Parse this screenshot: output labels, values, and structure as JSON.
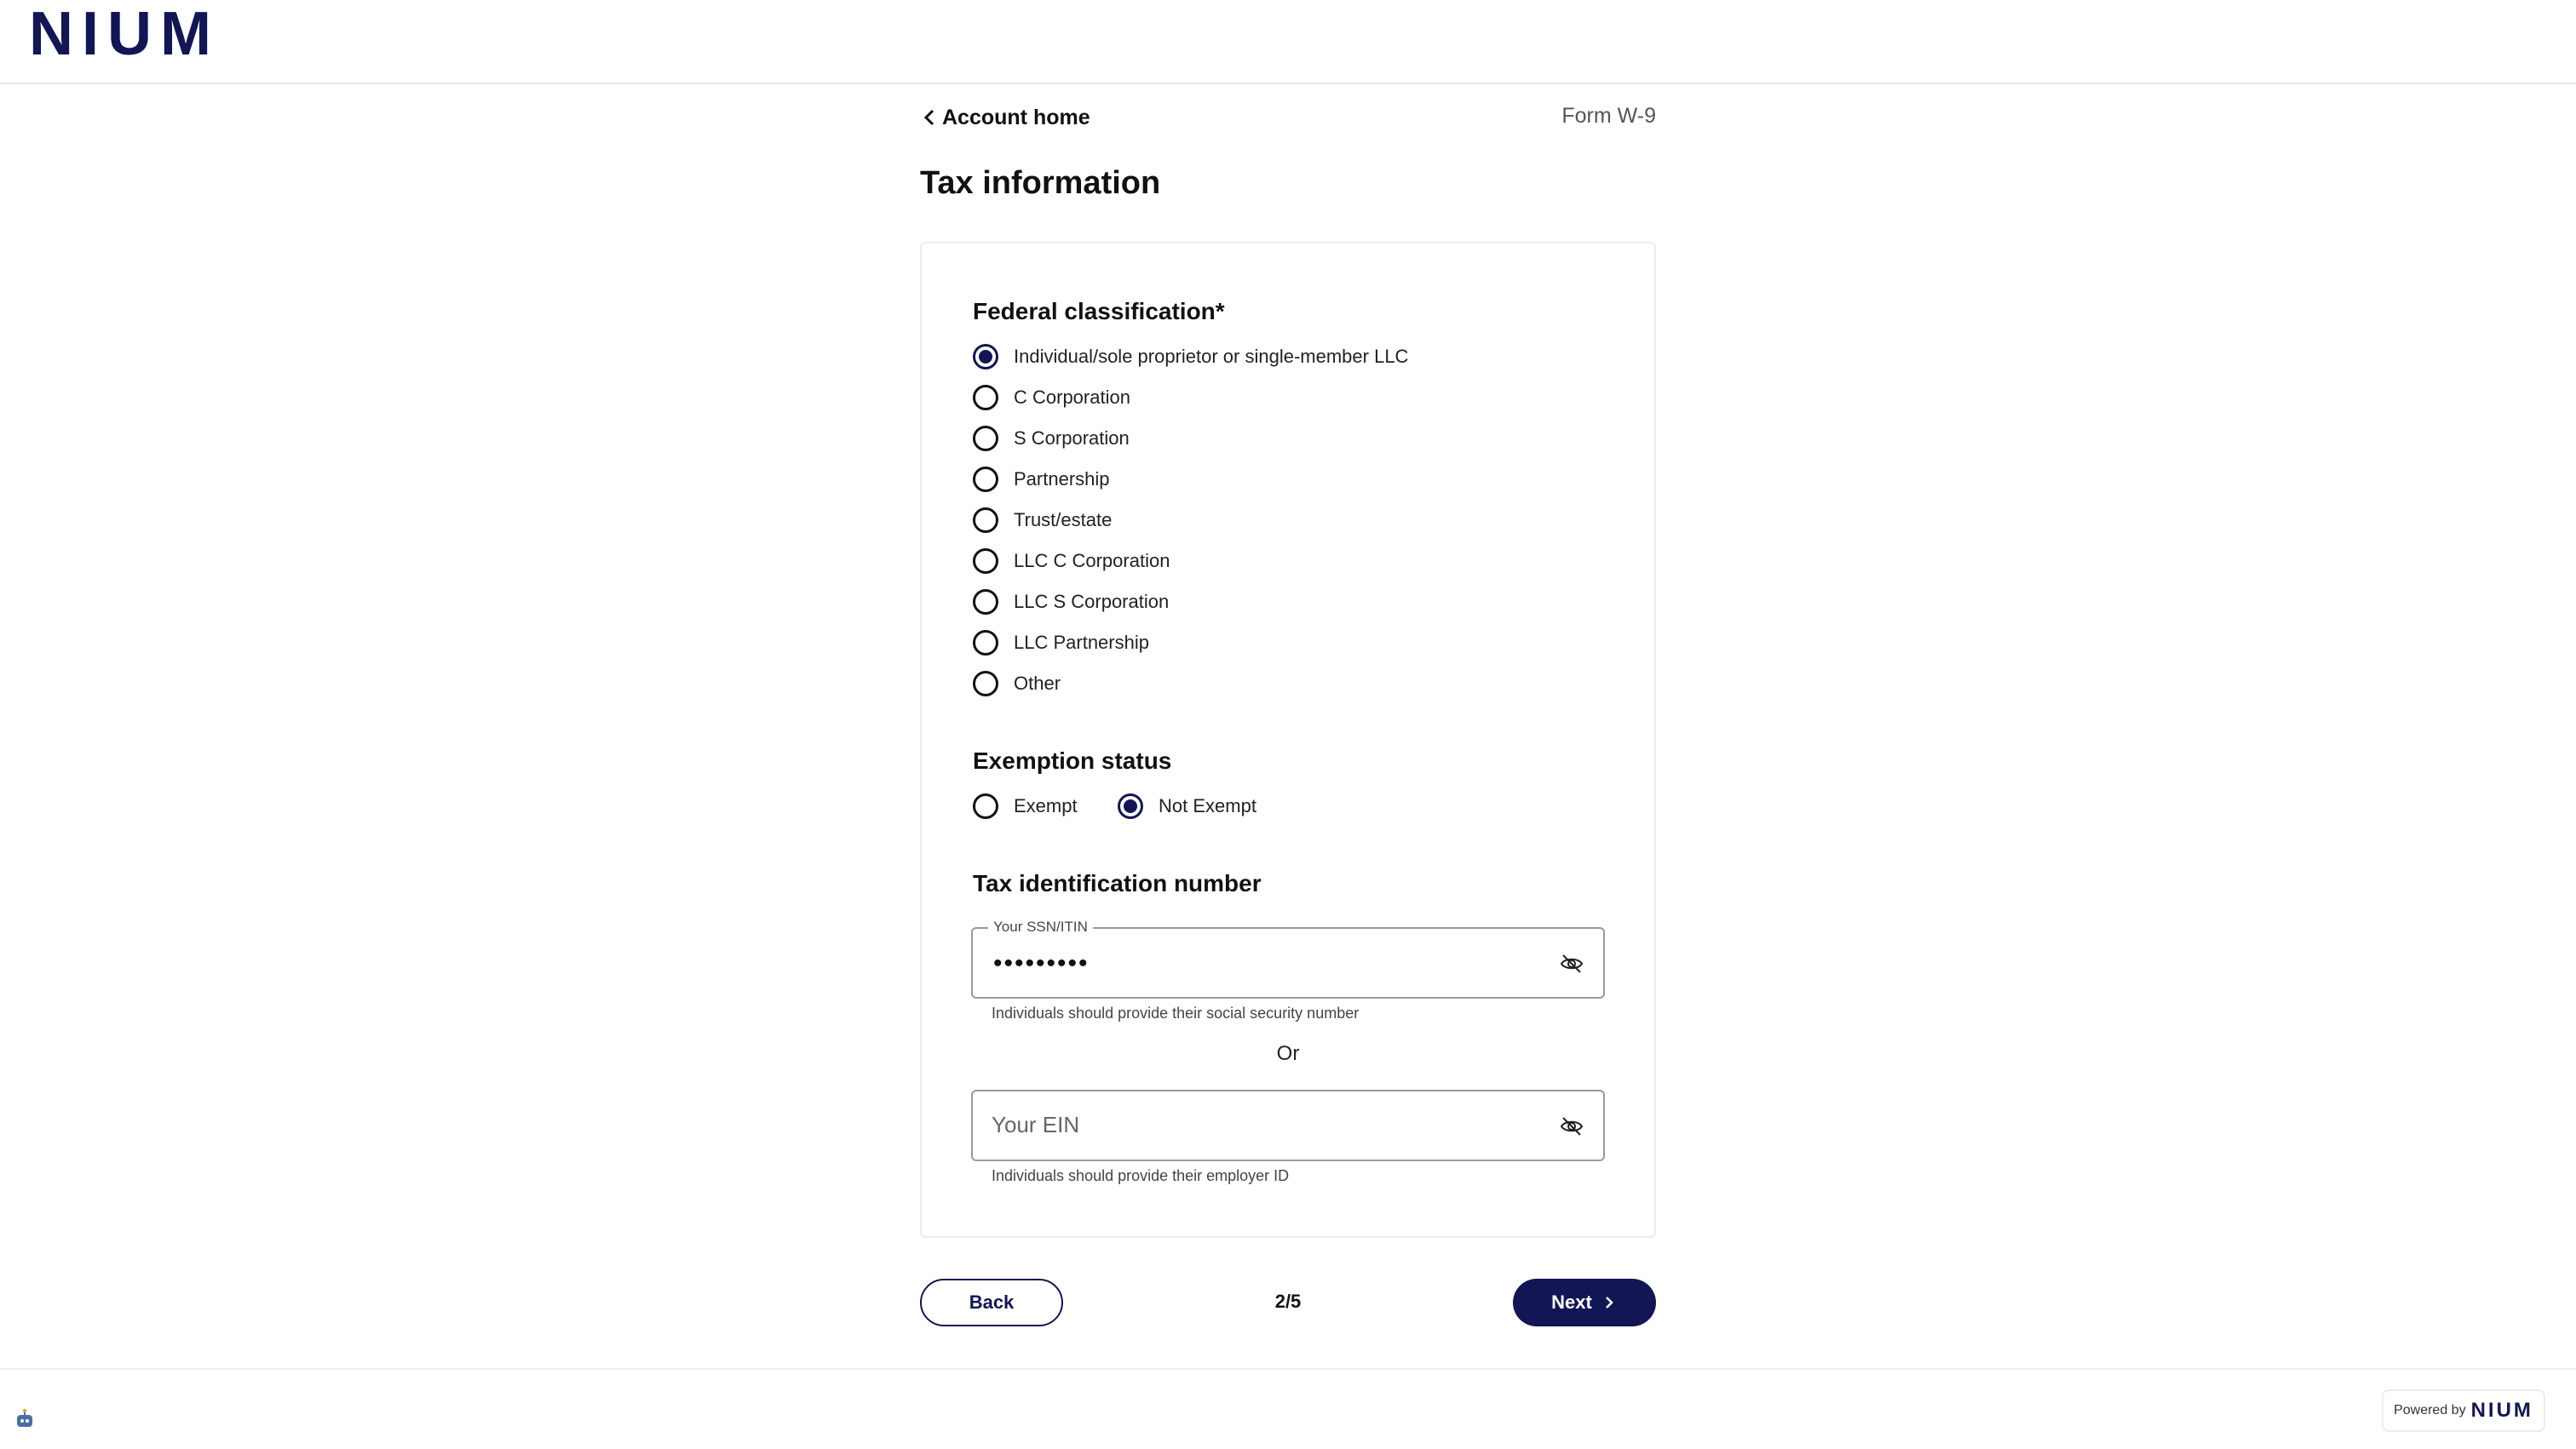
{
  "brand": {
    "logo_text": "NIUM",
    "color": "#121654"
  },
  "nav": {
    "back_label": "Account home",
    "form_name": "Form W-9"
  },
  "page": {
    "title": "Tax information"
  },
  "federal_classification": {
    "title": "Federal classification*",
    "selected": "Individual/sole proprietor or single-member LLC",
    "options": [
      "Individual/sole proprietor or single-member LLC",
      "C Corporation",
      "S Corporation",
      "Partnership",
      "Trust/estate",
      "LLC C Corporation",
      "LLC S Corporation",
      "LLC Partnership",
      "Other"
    ]
  },
  "exemption_status": {
    "title": "Exemption status",
    "selected": "Not Exempt",
    "options": [
      "Exempt",
      "Not Exempt"
    ]
  },
  "tin": {
    "title": "Tax identification number",
    "ssn": {
      "label": "Your SSN/ITIN",
      "value": "•••••••••",
      "helper": "Individuals should provide their social security number",
      "visibility_icon": "eye-off-icon"
    },
    "or_text": "Or",
    "ein": {
      "placeholder": "Your EIN",
      "value": "",
      "helper": "Individuals should provide their employer ID",
      "visibility_icon": "eye-off-icon"
    }
  },
  "footer_nav": {
    "back_label": "Back",
    "step": "2/5",
    "next_label": "Next"
  },
  "powered_by": {
    "prefix": "Powered by",
    "brand": "NIUM"
  }
}
